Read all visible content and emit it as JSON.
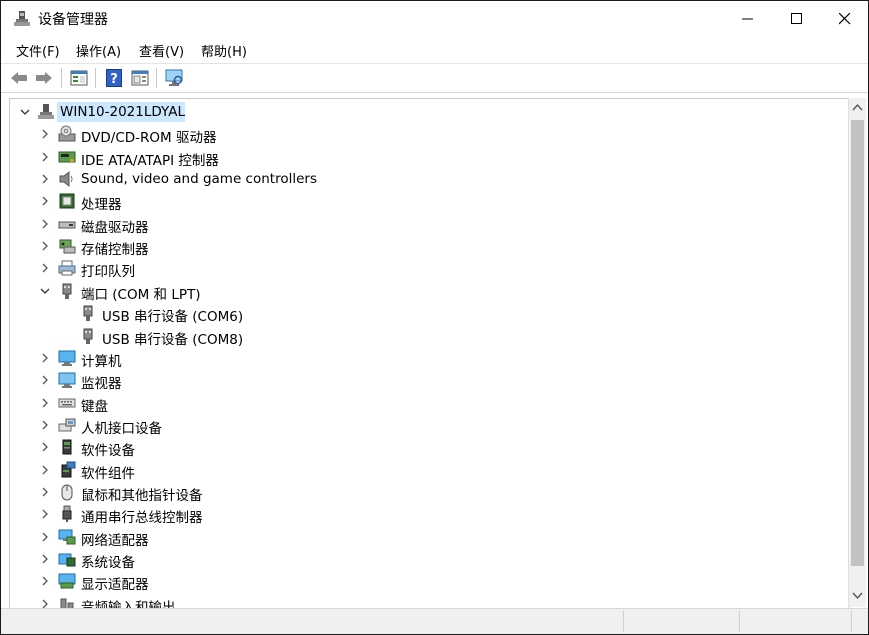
{
  "window": {
    "title": "设备管理器"
  },
  "menu": [
    {
      "label": "文件(F)"
    },
    {
      "label": "操作(A)"
    },
    {
      "label": "查看(V)"
    },
    {
      "label": "帮助(H)"
    }
  ],
  "toolbar": {
    "buttons": [
      "back-arrow-icon",
      "forward-arrow-icon",
      "properties-icon",
      "help-icon",
      "update-driver-icon",
      "scan-hardware-icon"
    ]
  },
  "tree": {
    "root": {
      "label": "WIN10-2021LDYAL",
      "expanded": true
    },
    "items": [
      {
        "label": "DVD/CD-ROM 驱动器",
        "icon": "dvd-drive-icon"
      },
      {
        "label": "IDE ATA/ATAPI 控制器",
        "icon": "ide-controller-icon"
      },
      {
        "label": "Sound, video and game controllers",
        "icon": "speaker-icon"
      },
      {
        "label": "处理器",
        "icon": "processor-icon"
      },
      {
        "label": "磁盘驱动器",
        "icon": "disk-drive-icon"
      },
      {
        "label": "存储控制器",
        "icon": "storage-controller-icon"
      },
      {
        "label": "打印队列",
        "icon": "printer-icon"
      },
      {
        "label": "端口 (COM 和 LPT)",
        "icon": "port-icon",
        "expanded": true,
        "children": [
          {
            "label": "USB 串行设备 (COM6)",
            "icon": "port-icon"
          },
          {
            "label": "USB 串行设备 (COM8)",
            "icon": "port-icon"
          }
        ]
      },
      {
        "label": "计算机",
        "icon": "computer-icon"
      },
      {
        "label": "监视器",
        "icon": "monitor-icon"
      },
      {
        "label": "键盘",
        "icon": "keyboard-icon"
      },
      {
        "label": "人机接口设备",
        "icon": "hid-icon"
      },
      {
        "label": "软件设备",
        "icon": "software-device-icon"
      },
      {
        "label": "软件组件",
        "icon": "software-component-icon"
      },
      {
        "label": "鼠标和其他指针设备",
        "icon": "mouse-icon"
      },
      {
        "label": "通用串行总线控制器",
        "icon": "usb-icon"
      },
      {
        "label": "网络适配器",
        "icon": "network-adapter-icon"
      },
      {
        "label": "系统设备",
        "icon": "system-device-icon"
      },
      {
        "label": "显示适配器",
        "icon": "display-adapter-icon"
      },
      {
        "label": "音频输入和输出",
        "icon": "audio-io-icon"
      }
    ]
  },
  "colors": {
    "selection": "#cce8ff",
    "accent": "#0078d7"
  }
}
